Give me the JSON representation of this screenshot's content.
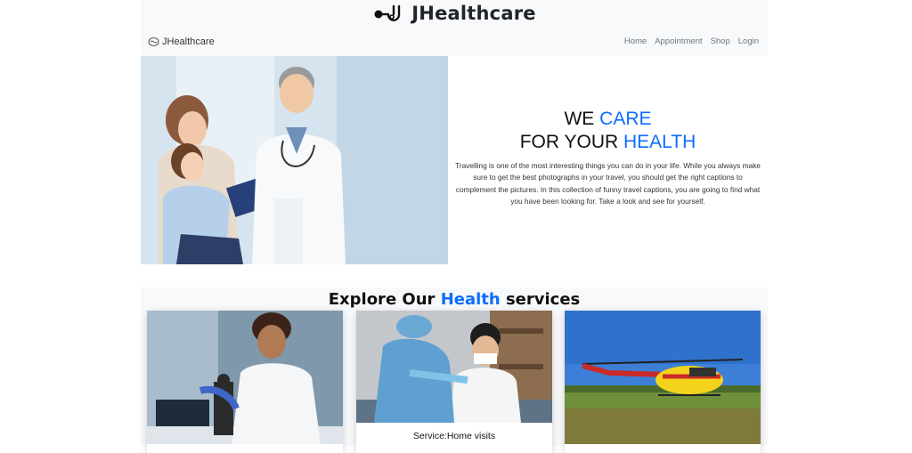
{
  "header": {
    "title": "JHealthcare",
    "icon": "stethoscope-icon"
  },
  "navbar": {
    "brand": "JHealthcare",
    "links": [
      "Home",
      "Appointment",
      "Shop",
      "Login"
    ]
  },
  "hero": {
    "title_line1_prefix": "WE ",
    "title_line1_accent": "CARE",
    "title_line2_prefix": "FOR YOUR ",
    "title_line2_accent": "HEALTH",
    "paragraph": "Travelling is one of the most interesting things you can do in your life. While you always make sure to get the best photographs in your travel, you should get the right captions to complement the pictures. In this collection of funny travel captions, you are going to find what you have been looking for. Take a look and see for yourself."
  },
  "services": {
    "title_prefix": "Explore Our ",
    "title_accent": "Health",
    "title_suffix": " services",
    "cards": [
      {
        "title": ""
      },
      {
        "title": "Service:Home visits"
      },
      {
        "title": ""
      }
    ]
  },
  "colors": {
    "accent": "#0d6efd",
    "navbar_bg": "#f8f9fa"
  }
}
